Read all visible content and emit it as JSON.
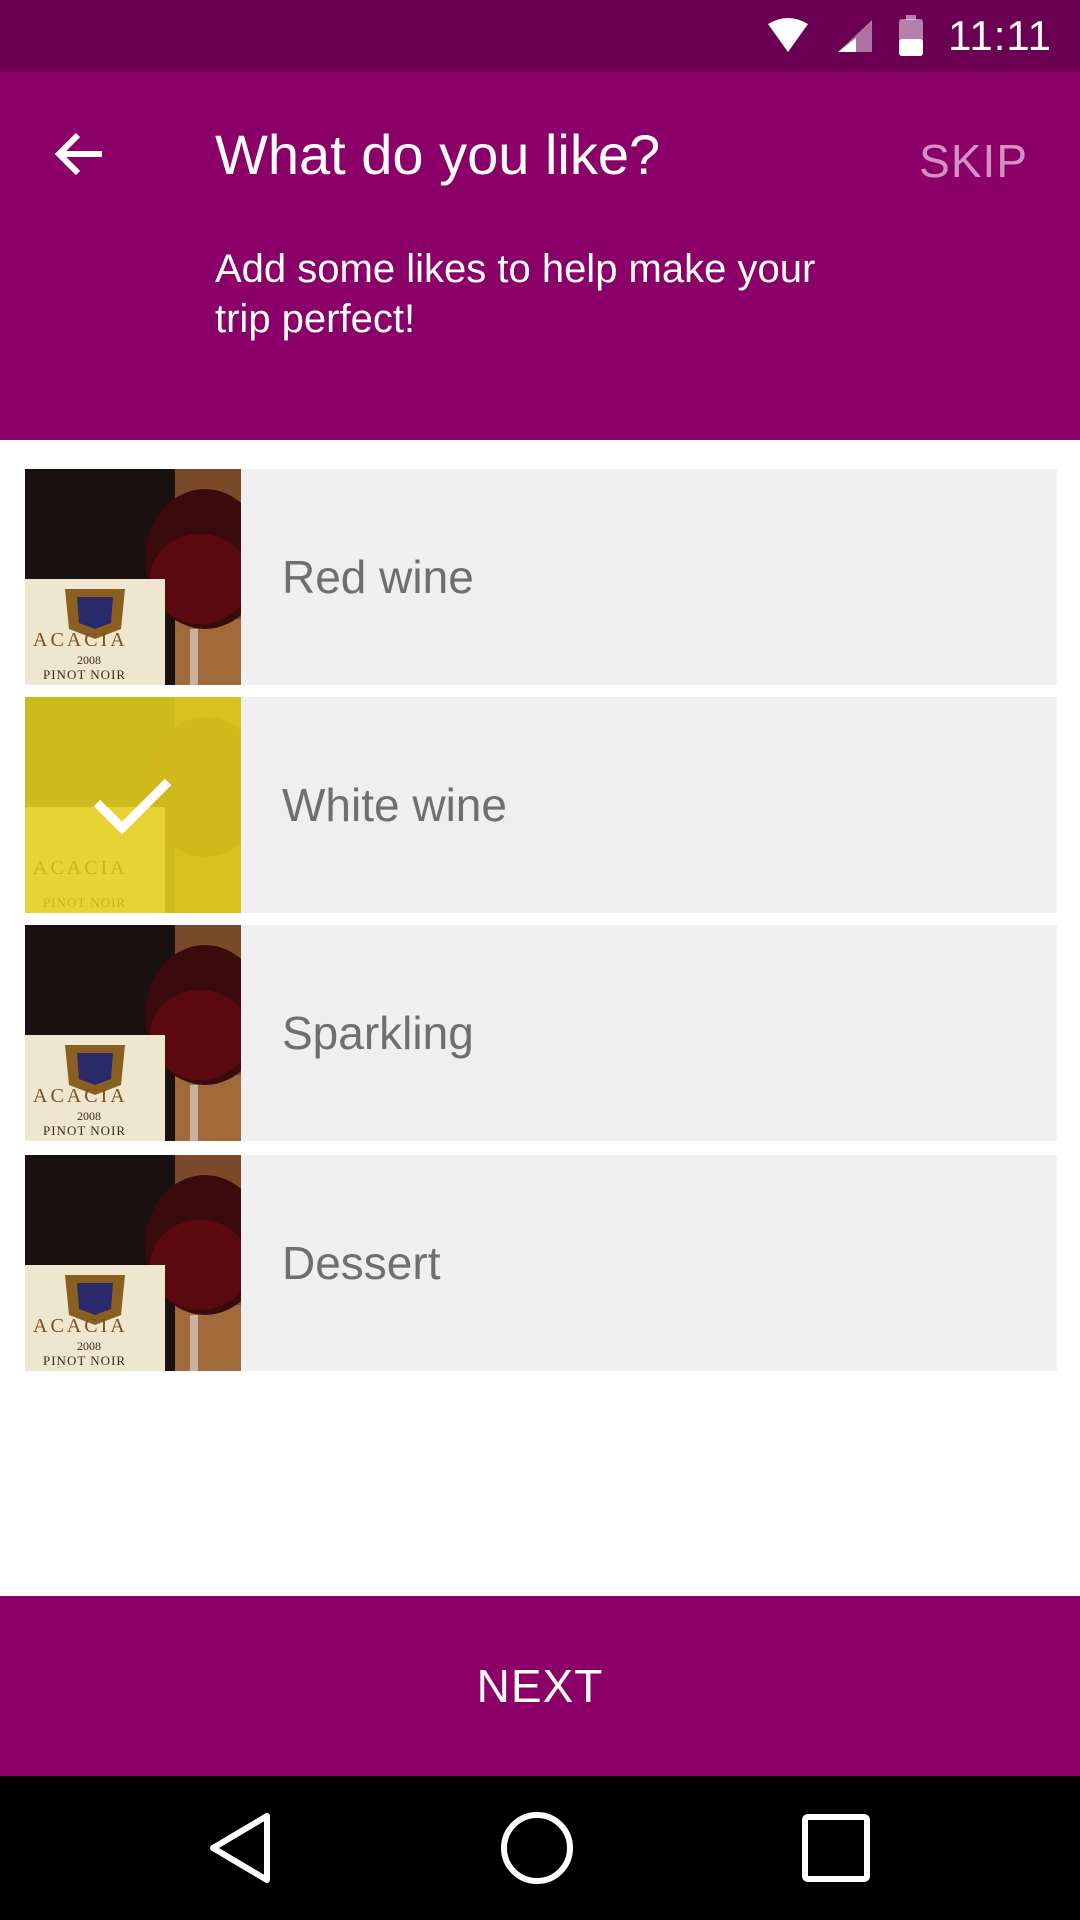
{
  "status_bar": {
    "time": "11:11",
    "icons": [
      "wifi-icon",
      "cell-signal-icon",
      "battery-icon"
    ]
  },
  "header": {
    "title": "What do you like?",
    "subtitle": "Add some likes to help make your trip perfect!",
    "skip_label": "SKIP",
    "back_icon": "arrow-left-icon"
  },
  "likes": {
    "items": [
      {
        "label": "Red wine",
        "selected": false
      },
      {
        "label": "White wine",
        "selected": true
      },
      {
        "label": "Sparkling",
        "selected": false
      },
      {
        "label": "Dessert",
        "selected": false
      }
    ],
    "thumbnail_text": {
      "brand": "ACACIA",
      "year": "2008",
      "variety": "PINOT NOIR"
    },
    "selected_overlay_color": "#e6d21e"
  },
  "footer": {
    "next_label": "NEXT"
  },
  "nav": {
    "icons": [
      "back-triangle-icon",
      "home-circle-icon",
      "recents-square-icon"
    ]
  },
  "colors": {
    "primary": "#8b0068",
    "primary_dark": "#6b0052",
    "skip": "#d490c2",
    "item_bg": "#efefef"
  }
}
